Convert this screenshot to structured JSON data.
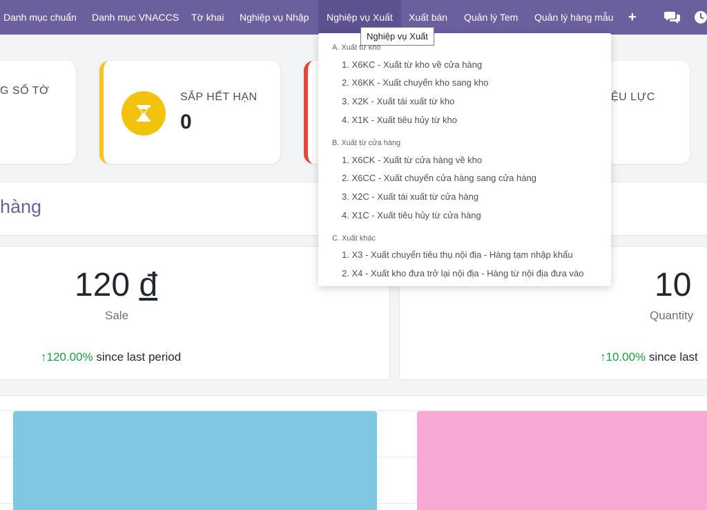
{
  "nav": {
    "items": [
      {
        "label": "Danh mục chuẩn"
      },
      {
        "label": "Danh mục VNACCS"
      },
      {
        "label": "Tờ khai"
      },
      {
        "label": "Nghiệp vụ Nhập"
      },
      {
        "label": "Nghiệp vụ Xuất"
      },
      {
        "label": "Xuất bán"
      },
      {
        "label": "Quản lý Tem"
      },
      {
        "label": "Quản lý hàng mẫu"
      }
    ],
    "plus": "+",
    "icons": [
      "chat-icon",
      "clock-icon"
    ],
    "tooltip": "Nghiệp vụ Xuất"
  },
  "stats": {
    "card1_title": "G SỐ TỜ",
    "card2_title": "SẮP HẾT HẠN",
    "card2_value": "0",
    "card4_title": "HIỆU LỰC"
  },
  "section": {
    "title": "hàng"
  },
  "kpis": [
    {
      "value": "120",
      "currency": "đ",
      "label": "Sale",
      "arrow": "↑",
      "pct": "120.00%",
      "since": "since last period"
    },
    {
      "value": "10",
      "label": "Quantity",
      "arrow": "↑",
      "pct": "10.00%",
      "since": "since last"
    }
  ],
  "dropdown": {
    "groups": [
      {
        "title": "A. Xuất từ kho",
        "items": [
          "1. X6KC - Xuất từ kho về cửa hàng",
          "2. X6KK - Xuất chuyển kho sang kho",
          "3. X2K - Xuất tái xuất từ kho",
          "4. X1K - Xuất tiêu hủy từ kho"
        ]
      },
      {
        "title": "B. Xuất từ cửa hàng",
        "items": [
          "1. X6CK - Xuất từ cửa hàng về kho",
          "2. X6CC - Xuất chuyển cửa hàng sang cửa hàng",
          "3. X2C - Xuất tái xuất từ cửa hàng",
          "4. X1C - Xuất tiêu hủy từ cửa hàng"
        ]
      },
      {
        "title": "C. Xuất khác",
        "items": [
          "1. X3 - Xuất chuyển tiêu thụ nội địa - Hàng tạm nhập khẩu",
          "2. X4 - Xuất kho đưa trở lại nội địa - Hàng từ nội địa đưa vào"
        ]
      }
    ]
  },
  "colors": {
    "nav_bg": "#6c5f9e",
    "accent_yellow": "#f6c51d",
    "accent_red": "#e04a3c",
    "chart_blue": "#7ec8e3",
    "chart_pink": "#f7a8d3",
    "up_green": "#199c3c"
  }
}
